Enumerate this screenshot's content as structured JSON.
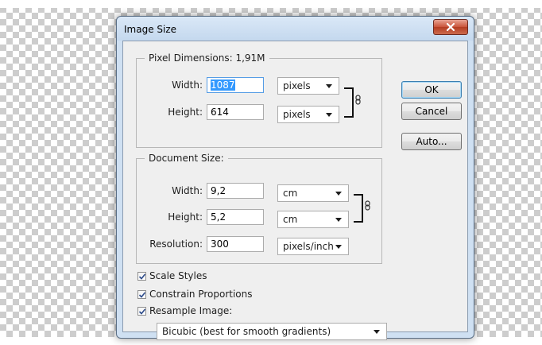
{
  "dialog": {
    "title": "Image Size",
    "close_icon": "close-x-icon"
  },
  "pixel_dimensions": {
    "legend": "Pixel Dimensions: 1,91M",
    "width_label": "Width:",
    "width_value": "1087",
    "width_unit": "pixels",
    "height_label": "Height:",
    "height_value": "614",
    "height_unit": "pixels",
    "link_icon": "chain-link-icon"
  },
  "document_size": {
    "legend": "Document Size:",
    "width_label": "Width:",
    "width_value": "9,2",
    "width_unit": "cm",
    "height_label": "Height:",
    "height_value": "5,2",
    "height_unit": "cm",
    "resolution_label": "Resolution:",
    "resolution_value": "300",
    "resolution_unit": "pixels/inch",
    "link_icon": "chain-link-icon"
  },
  "buttons": {
    "ok": "OK",
    "cancel": "Cancel",
    "auto": "Auto..."
  },
  "options": {
    "scale_styles": {
      "label": "Scale Styles",
      "checked": true
    },
    "constrain_proportions": {
      "label": "Constrain Proportions",
      "checked": true
    },
    "resample_image": {
      "label": "Resample Image:",
      "checked": true
    }
  },
  "resample_method": "Bicubic (best for smooth gradients)",
  "colors": {
    "accent_blue": "#569de5",
    "selection": "#3399ff",
    "close_red": "#c9553a",
    "frame": "#cfe0f2"
  }
}
